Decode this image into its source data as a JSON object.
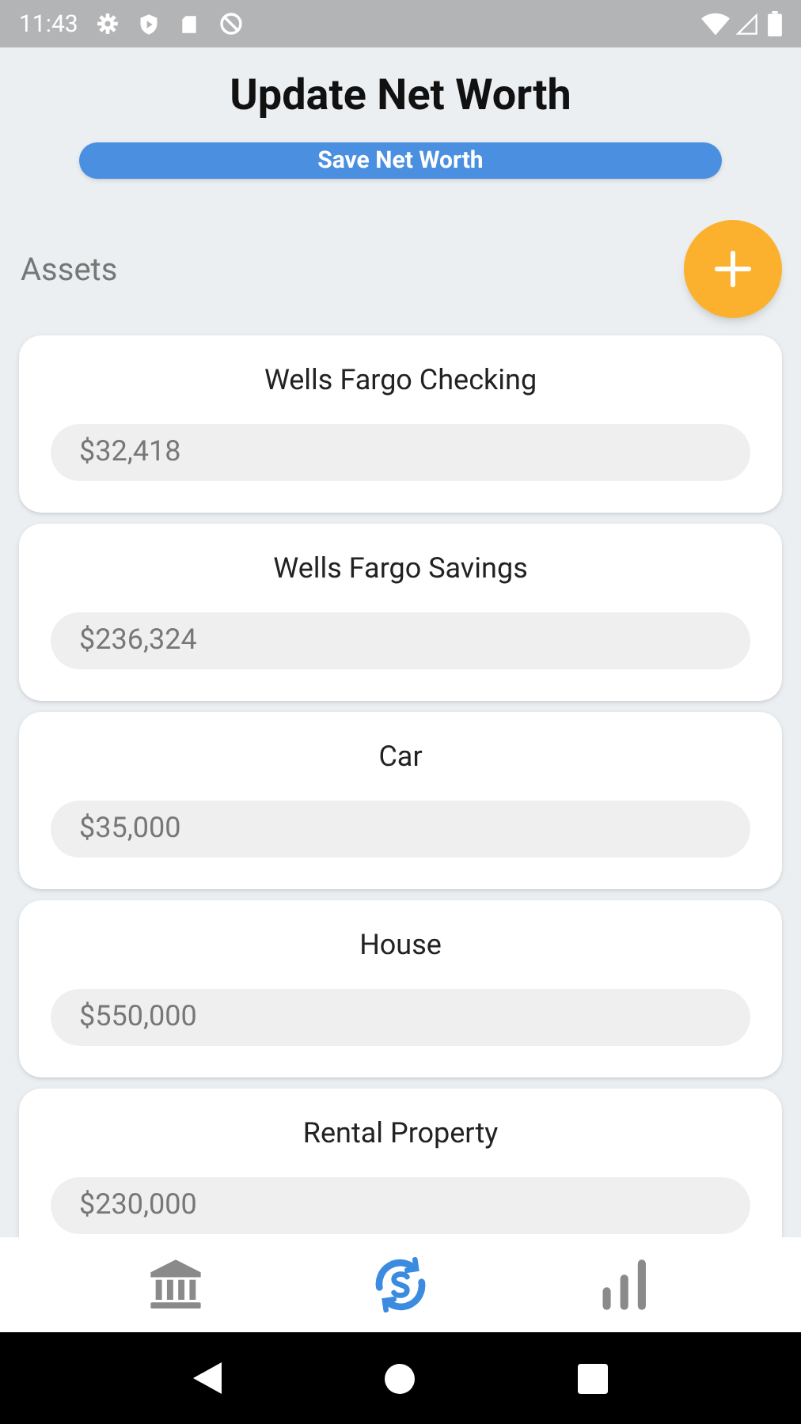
{
  "status_bar": {
    "time": "11:43"
  },
  "header": {
    "title": "Update Net Worth",
    "save_button": "Save Net Worth"
  },
  "section": {
    "title": "Assets"
  },
  "assets": [
    {
      "name": "Wells Fargo Checking",
      "value": "$32,418"
    },
    {
      "name": "Wells Fargo Savings",
      "value": "$236,324"
    },
    {
      "name": "Car",
      "value": "$35,000"
    },
    {
      "name": "House",
      "value": "$550,000"
    },
    {
      "name": "Rental Property",
      "value": "$230,000"
    }
  ],
  "bottom_nav": [
    {
      "kind": "accounts",
      "selected": false
    },
    {
      "kind": "update",
      "selected": true
    },
    {
      "kind": "charts",
      "selected": false
    }
  ]
}
